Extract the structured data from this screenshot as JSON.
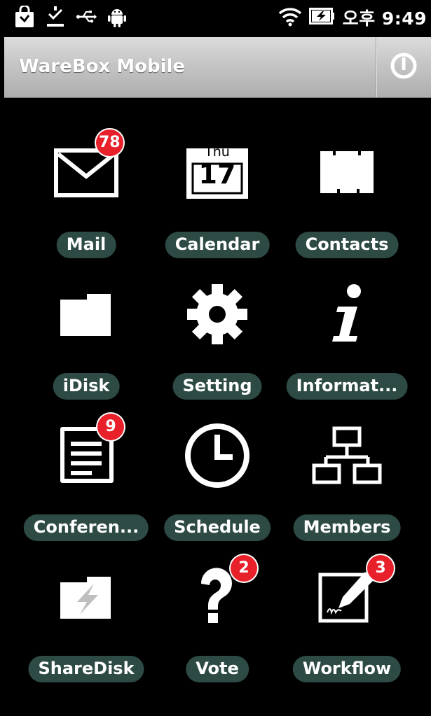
{
  "status_bar": {
    "time": "오후 9:49",
    "icons": [
      "shopping-bag-icon",
      "download-icon",
      "usb-icon",
      "android-icon",
      "wifi-icon",
      "battery-charging-icon"
    ]
  },
  "app_bar": {
    "title": "WareBox Mobile",
    "power_icon": "power-icon"
  },
  "calendar_icon": {
    "weekday": "Thu",
    "day": "17"
  },
  "tiles": [
    {
      "label": "Mail",
      "icon": "mail-icon",
      "badge": "78"
    },
    {
      "label": "Calendar",
      "icon": "calendar-icon",
      "badge": null
    },
    {
      "label": "Contacts",
      "icon": "contacts-icon",
      "badge": null
    },
    {
      "label": "iDisk",
      "icon": "folder-icon",
      "badge": null
    },
    {
      "label": "Setting",
      "icon": "gear-icon",
      "badge": null
    },
    {
      "label": "Informat...",
      "icon": "info-icon",
      "badge": null
    },
    {
      "label": "Conferen...",
      "icon": "document-icon",
      "badge": "9"
    },
    {
      "label": "Schedule",
      "icon": "clock-icon",
      "badge": null
    },
    {
      "label": "Members",
      "icon": "org-chart-icon",
      "badge": null
    },
    {
      "label": "ShareDisk",
      "icon": "shared-folder-icon",
      "badge": null
    },
    {
      "label": "Vote",
      "icon": "question-mark-icon",
      "badge": "2"
    },
    {
      "label": "Workflow",
      "icon": "sign-pen-icon",
      "badge": "3"
    }
  ],
  "colors": {
    "label_bg": "#2d4a44",
    "badge_bg": "#e8202a",
    "appbar_top": "#dcdcdc",
    "appbar_bottom": "#aeaeae"
  }
}
